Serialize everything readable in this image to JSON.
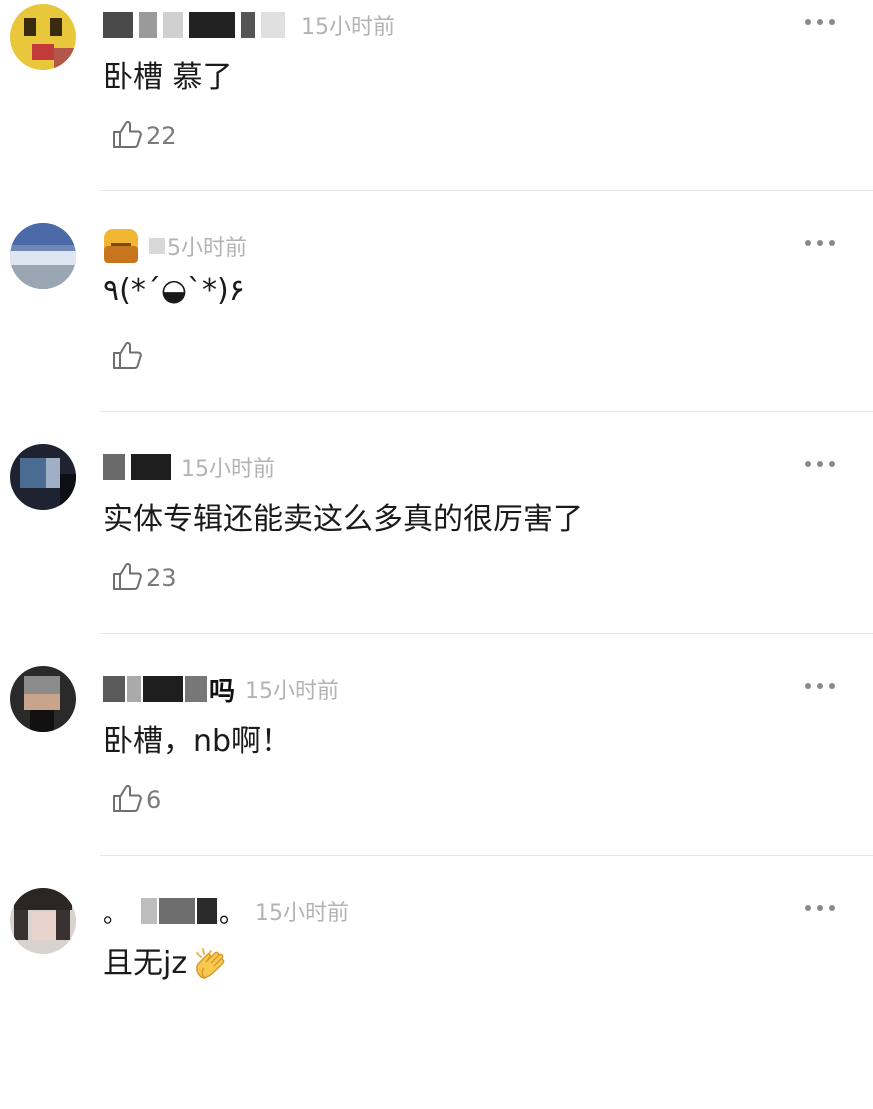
{
  "comments": [
    {
      "time": "15小时前",
      "text": "卧槽 慕了",
      "likes": "22"
    },
    {
      "time": "5小时前",
      "text": "٩(*´◒`*)۶",
      "likes": ""
    },
    {
      "time": "15小时前",
      "text": "实体专辑还能卖这么多真的很厉害了",
      "likes": "23"
    },
    {
      "time": "15小时前",
      "name_tail": "吗",
      "text": "卧槽，nb啊！",
      "likes": "6"
    },
    {
      "time": "15小时前",
      "name_tail": "。",
      "text": "且无jz",
      "text_emoji": "clapping-hands"
    }
  ],
  "icons": {
    "like": "thumbs-up-outline-icon",
    "more": "more-dots-icon"
  },
  "colors": {
    "text": "#1a1a1a",
    "meta": "#b3b3b3",
    "divider": "#e6e6e6"
  }
}
